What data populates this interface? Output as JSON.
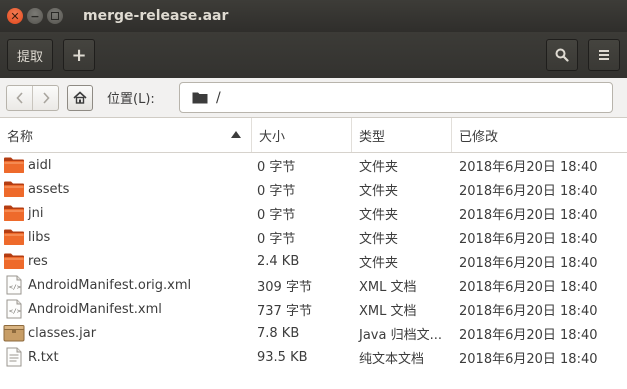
{
  "window": {
    "title": "merge-release.aar"
  },
  "toolbar": {
    "extract_label": "提取",
    "add_label": "+"
  },
  "location": {
    "label": "位置(L):",
    "path": "/"
  },
  "columns": {
    "name": "名称",
    "size": "大小",
    "type": "类型",
    "modified": "已修改"
  },
  "files": [
    {
      "name": "aidl",
      "size": "0 字节",
      "type": "文件夹",
      "modified": "2018年6月20日 18:40",
      "icon": "folder-icon"
    },
    {
      "name": "assets",
      "size": "0 字节",
      "type": "文件夹",
      "modified": "2018年6月20日 18:40",
      "icon": "folder-icon"
    },
    {
      "name": "jni",
      "size": "0 字节",
      "type": "文件夹",
      "modified": "2018年6月20日 18:40",
      "icon": "folder-icon"
    },
    {
      "name": "libs",
      "size": "0 字节",
      "type": "文件夹",
      "modified": "2018年6月20日 18:40",
      "icon": "folder-icon"
    },
    {
      "name": "res",
      "size": "2.4 KB",
      "type": "文件夹",
      "modified": "2018年6月20日 18:40",
      "icon": "folder-icon"
    },
    {
      "name": "AndroidManifest.orig.xml",
      "size": "309 字节",
      "type": "XML 文档",
      "modified": "2018年6月20日 18:40",
      "icon": "xml-file-icon"
    },
    {
      "name": "AndroidManifest.xml",
      "size": "737 字节",
      "type": "XML 文档",
      "modified": "2018年6月20日 18:40",
      "icon": "xml-file-icon"
    },
    {
      "name": "classes.jar",
      "size": "7.8 KB",
      "type": "Java 归档文...",
      "modified": "2018年6月20日 18:40",
      "icon": "jar-archive-icon"
    },
    {
      "name": "R.txt",
      "size": "93.5 KB",
      "type": "纯文本文档",
      "modified": "2018年6月20日 18:40",
      "icon": "text-file-icon"
    }
  ],
  "colors": {
    "folder": "#e95420",
    "titlebar": "#3c3b37"
  }
}
